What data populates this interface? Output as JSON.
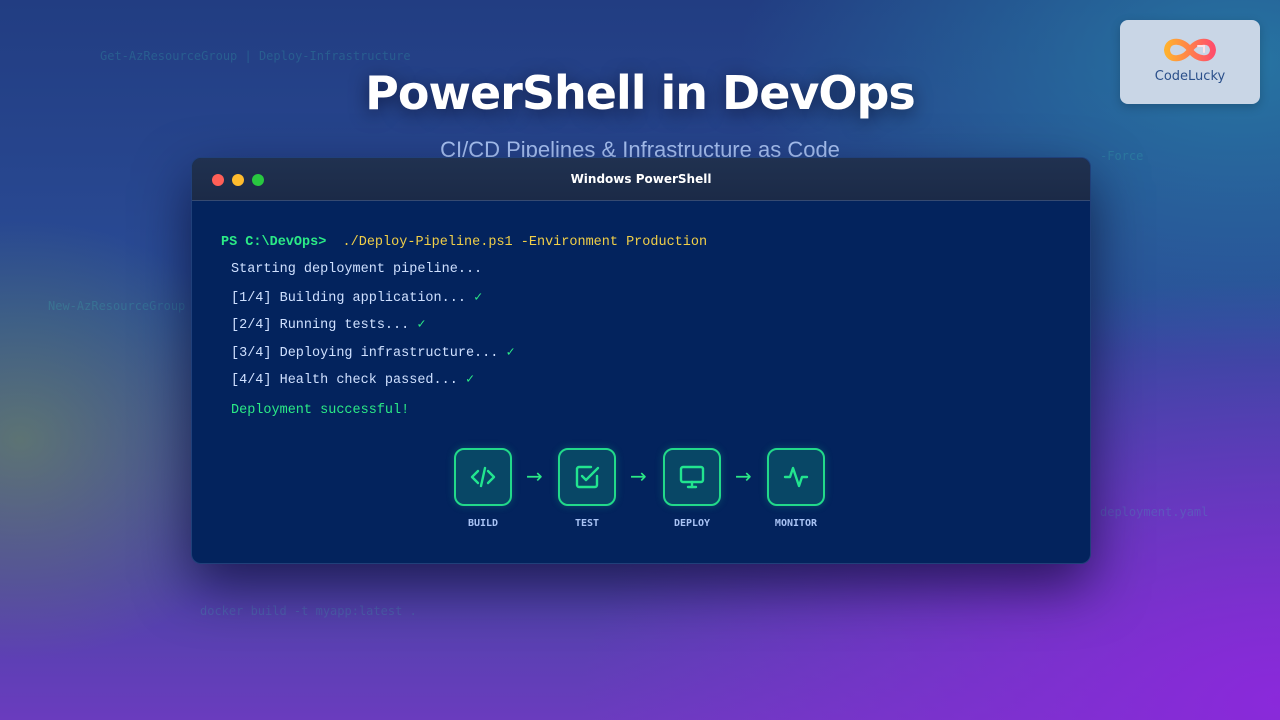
{
  "background_snippets": [
    "Get-AzResourceGroup | Deploy-Infrastructure",
    "New-AzResourceGroup",
    "docker build -t myapp:latest .",
    "-Force",
    "deployment.yaml"
  ],
  "header": {
    "title": "PowerShell in DevOps",
    "subtitle": "CI/CD Pipelines & Infrastructure as Code"
  },
  "logo": {
    "text": "CodeLucky"
  },
  "window": {
    "title": "Windows PowerShell",
    "prompt": "PS C:\\DevOps>",
    "command": "./Deploy-Pipeline.ps1 -Environment Production",
    "output": [
      {
        "text": "Starting deployment pipeline...",
        "check": ""
      },
      {
        "text": "[1/4] Building application...",
        "check": "✓"
      },
      {
        "text": "[2/4] Running tests...",
        "check": "✓"
      },
      {
        "text": "[3/4] Deploying infrastructure...",
        "check": "✓"
      },
      {
        "text": "[4/4] Health check passed...",
        "check": "✓"
      }
    ],
    "success": "Deployment successful!"
  },
  "pipeline": {
    "stages": [
      {
        "label": "BUILD",
        "icon": "code-icon"
      },
      {
        "label": "TEST",
        "icon": "checkbox-icon"
      },
      {
        "label": "DEPLOY",
        "icon": "monitor-icon"
      },
      {
        "label": "MONITOR",
        "icon": "activity-icon"
      }
    ],
    "arrow": "→"
  },
  "colors": {
    "accent_green": "#2bea86",
    "command_yellow": "#f1cf48",
    "terminal_bg": "#03235d"
  }
}
